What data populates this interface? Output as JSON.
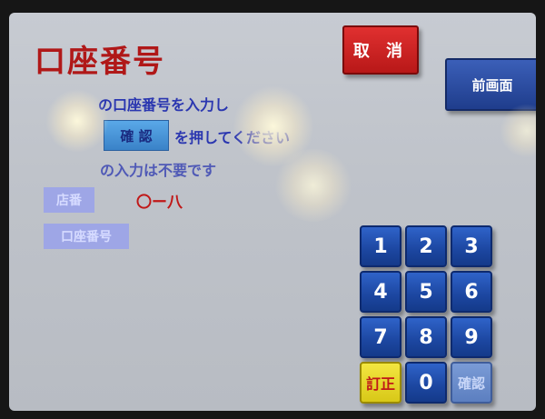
{
  "screen": {
    "title": "口座番号",
    "cancel_label": "取 消",
    "prev_label": "前画面",
    "instructions": {
      "line1": "の口座番号を入力し",
      "confirm_label": "確 認",
      "line2": "を押してください",
      "line3": "の入力は不要です"
    },
    "fields": {
      "branch_label": "店番",
      "branch_value": "〇ー八",
      "account_label": "口座番号"
    },
    "keypad": {
      "keys": [
        "1",
        "2",
        "3",
        "4",
        "5",
        "6",
        "7",
        "8",
        "9"
      ],
      "correct_label": "訂正",
      "zero_label": "0",
      "ok_label": "確認"
    }
  },
  "colors": {
    "title": "#b01818",
    "cancel": "#c82020",
    "key_blue": "#1f4aa8",
    "correct_yellow": "#e8dc30",
    "instruction_text": "#2a36b0"
  }
}
